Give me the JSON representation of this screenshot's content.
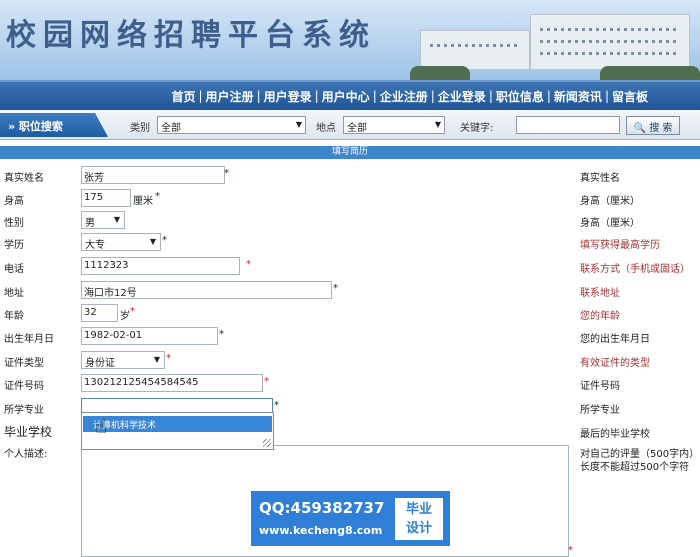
{
  "banner": {
    "title": "校园网络招聘平台系统"
  },
  "nav": [
    "首页",
    "用户注册",
    "用户登录",
    "用户中心",
    "企业注册",
    "企业登录",
    "职位信息",
    "新闻资讯",
    "留言板"
  ],
  "search": {
    "tab_label": "» 职位搜索",
    "category_label": "类别",
    "category_value": "全部",
    "location_label": "地点",
    "location_value": "全部",
    "keyword_label": "关键字:",
    "search_button": "搜 索"
  },
  "section_title": "填写简历",
  "form": {
    "name_label": "真实姓名",
    "name_value": "张芳",
    "name_hint": "真实性名",
    "height_label": "身高",
    "height_value": "175",
    "height_unit": "厘米",
    "height_hint": "身高（厘米）",
    "gender_label": "性别",
    "gender_value": "男",
    "gender_hint": "身高（厘米）",
    "edu_label": "学历",
    "edu_value": "大专",
    "edu_hint": "填写获得最高学历",
    "phone_label": "电话",
    "phone_value": "1112323",
    "phone_hint": "联系方式（手机或固话）",
    "addr_label": "地址",
    "addr_value": "海口市12号",
    "addr_hint": "联系地址",
    "age_label": "年龄",
    "age_value": "32",
    "age_unit": "岁",
    "age_hint": "您的年龄",
    "birth_label": "出生年月日",
    "birth_value": "1982-02-01",
    "birth_hint": "您的出生年月日",
    "idtype_label": "证件类型",
    "idtype_value": "身份证",
    "idtype_hint": "有效证件的类型",
    "idnum_label": "证件号码",
    "idnum_value": "130212125454584545",
    "idnum_hint": "证件号码",
    "major_label": "所学专业",
    "major_value": "",
    "major_hint": "所学专业",
    "school_label": "毕业学校",
    "school_hint": "最后的毕业学校",
    "desc_label": "个人描述:",
    "desc_hint1": "对自己的评量（500字内）",
    "desc_hint2": "长度不能超过500个字符"
  },
  "suggestion": "计算机科学技术",
  "watermark": {
    "qq": "QQ:459382737",
    "url": "www.kecheng8.com",
    "tag_line1": "毕业",
    "tag_line2": "设计"
  }
}
